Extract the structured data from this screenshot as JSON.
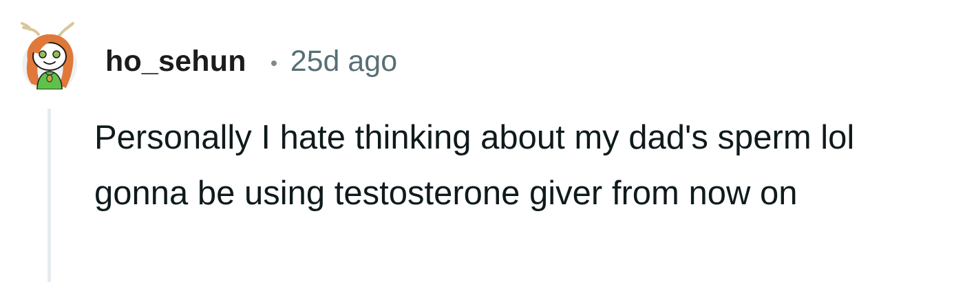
{
  "comment": {
    "username": "ho_sehun",
    "separator": "•",
    "timestamp": "25d ago",
    "body": "Personally I hate thinking about my dad's sperm lol gonna be using testosterone giver from now on",
    "avatar_icon": "reddit-snoo-avatar-icon",
    "colors": {
      "username": "#1c1c1c",
      "timestamp": "#576f76",
      "body": "#0f1a1c",
      "thread_line": "#e5ebee",
      "avatar_hair": "#e0783a",
      "avatar_outfit": "#5fc14a"
    }
  }
}
